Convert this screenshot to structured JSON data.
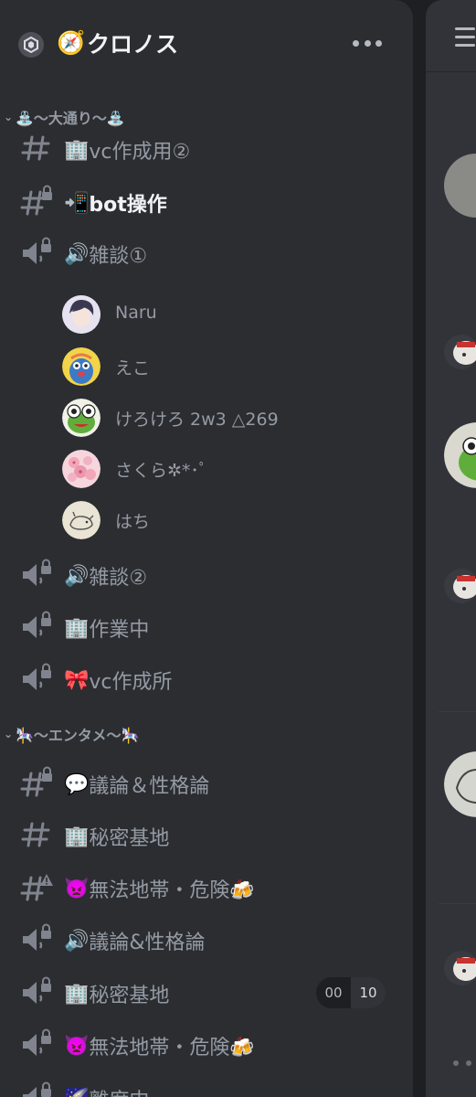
{
  "server": {
    "emoji": "🧭",
    "name": "クロノス",
    "icon": "server-boost-icon",
    "more_icon": "more-icon"
  },
  "categories": [
    {
      "label": "⛲～大通り～⛲"
    },
    {
      "label": "🎠～エンタメ～🎠"
    }
  ],
  "channels": [
    {
      "emoji": "🏢",
      "label": "vc作成用②",
      "type": "text"
    },
    {
      "emoji": "📲",
      "label": "bot操作",
      "type": "text-locked",
      "active": true
    },
    {
      "emoji": "🔊",
      "label": "雑談①",
      "type": "voice-locked"
    },
    {
      "emoji": "🔊",
      "label": "雑談②",
      "type": "voice-locked"
    },
    {
      "emoji": "🏢",
      "label": "作業中",
      "type": "voice-locked"
    },
    {
      "emoji": "🎀",
      "label": "vc作成所",
      "type": "voice-locked"
    },
    {
      "emoji": "💬",
      "label": "議論＆性格論",
      "type": "text-locked"
    },
    {
      "emoji": "🏢",
      "label": "秘密基地",
      "type": "text"
    },
    {
      "emoji": "👿",
      "label": "無法地帯・危険🍻",
      "type": "text-nsfw"
    },
    {
      "emoji": "🔊",
      "label": "議論&性格論",
      "type": "voice-locked"
    },
    {
      "emoji": "🏢",
      "label": "秘密基地",
      "type": "voice-locked"
    },
    {
      "emoji": "👿",
      "label": "無法地帯・危険🍻",
      "type": "voice-locked"
    },
    {
      "emoji": "🌠",
      "label": "離席中",
      "type": "voice-locked"
    }
  ],
  "voice_users": [
    {
      "name": "Naru"
    },
    {
      "name": "えこ"
    },
    {
      "name": "けろけろ 2w3 △269"
    },
    {
      "name": "さくら✲*･ﾟ"
    },
    {
      "name": "はち"
    }
  ],
  "counter": {
    "left": "00",
    "right": "10"
  },
  "colors": {
    "bg": "#1e1f22",
    "panel": "#2b2d31",
    "active_text": "#f2f3f5",
    "muted_text": "#949ba4"
  }
}
